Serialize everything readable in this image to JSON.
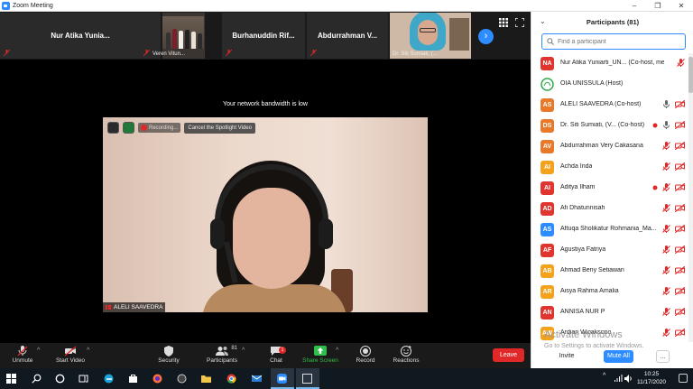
{
  "window": {
    "title": "Zoom Meeting",
    "controls": [
      "–",
      "❐",
      "✕"
    ]
  },
  "gallery": {
    "tiles": [
      {
        "name": "Nur Atika Yunia...",
        "caption": ""
      },
      {
        "name": "",
        "caption": "Veren Vitun..."
      },
      {
        "name": "Burhanuddin Rif...",
        "caption": ""
      },
      {
        "name": "Abdurrahman V...",
        "caption": ""
      },
      {
        "name": "",
        "caption": "Dr. Siti Sumiati, (..."
      }
    ],
    "next_label": "›"
  },
  "notice": "Your network bandwidth is low",
  "spotlight": {
    "recording_label": "Recording...",
    "cancel_label": "Cancel the Spotlight Video",
    "speaker_name": "ALELI SAAVEDRA"
  },
  "toolbar": {
    "unmute": "Unmute",
    "start_video": "Start Video",
    "security": "Security",
    "participants": "Participants",
    "participants_count": "81",
    "chat": "Chat",
    "chat_badge": "1",
    "share_screen": "Share Screen",
    "record": "Record",
    "reactions": "Reactions",
    "leave": "Leave",
    "caret": "^"
  },
  "participants_panel": {
    "title": "Participants (81)",
    "search_placeholder": "Find a participant",
    "invite": "Invite",
    "mute_all": "Mute All",
    "more": "...",
    "watermark_line1": "Activate Windows",
    "watermark_line2": "Go to Settings to activate Windows.",
    "items": [
      {
        "initials": "NA",
        "name": "Nur Atika Yuniarti_UN...  (Co-host, me)",
        "color": "#e0342f",
        "mic": "muted",
        "video": "none"
      },
      {
        "initials": "",
        "name": "OIA UNISSULA (Host)",
        "color": "#ffffff",
        "mic": "none",
        "video": "none",
        "logo": true
      },
      {
        "initials": "AS",
        "name": "ALELI SAAVEDRA (Co-host)",
        "color": "#e8792a",
        "mic": "on",
        "video": "off"
      },
      {
        "initials": "DS",
        "name": "Dr. Siti Sumiati, (V...  (Co-host)",
        "color": "#e8792a",
        "mic": "on",
        "video": "off",
        "rec": true
      },
      {
        "initials": "AV",
        "name": "Abdurrahman Very Cakasana",
        "color": "#e8792a",
        "mic": "muted",
        "video": "off"
      },
      {
        "initials": "AI",
        "name": "Achda Inda",
        "color": "#f4a21c",
        "mic": "muted",
        "video": "off"
      },
      {
        "initials": "AI",
        "name": "Aditya Ilham",
        "color": "#e0342f",
        "mic": "muted",
        "video": "off",
        "rec": true
      },
      {
        "initials": "AD",
        "name": "Afi Dhatunnisah",
        "color": "#e0342f",
        "mic": "muted",
        "video": "off"
      },
      {
        "initials": "AS",
        "name": "Aftuqa Sholikatur Rohmania_Ma...",
        "color": "#2d8cff",
        "mic": "muted",
        "video": "off"
      },
      {
        "initials": "AF",
        "name": "Agustiya Fatriya",
        "color": "#e0342f",
        "mic": "muted",
        "video": "off"
      },
      {
        "initials": "AB",
        "name": "Ahmad Beny Setiawan",
        "color": "#f4a21c",
        "mic": "muted",
        "video": "off"
      },
      {
        "initials": "AR",
        "name": "Aisya Rahma Amalia",
        "color": "#f4a21c",
        "mic": "muted",
        "video": "off"
      },
      {
        "initials": "AN",
        "name": "ANNISA NUR P",
        "color": "#e0342f",
        "mic": "muted",
        "video": "off"
      },
      {
        "initials": "AW",
        "name": "Ardian Wicaksono",
        "color": "#f4a21c",
        "mic": "muted",
        "video": "off"
      }
    ]
  },
  "taskbar": {
    "time": "10:25",
    "date": "11/17/2020",
    "tray_chevron": "^"
  },
  "colors": {
    "accent": "#2d8cff",
    "danger": "#e02828",
    "share_green": "#2fbf4a"
  }
}
